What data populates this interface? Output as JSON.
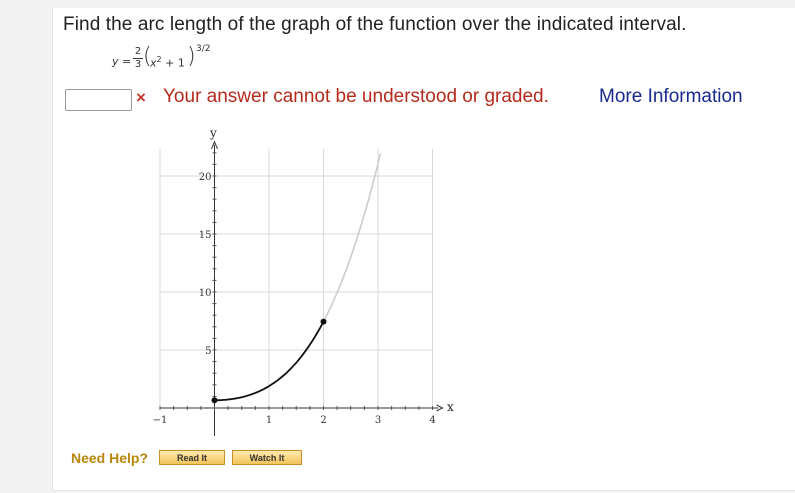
{
  "question": {
    "prompt": "Find the arc length of the graph of the function over the indicated interval.",
    "formula": {
      "lhs": "y",
      "eq": "=",
      "frac_num": "2",
      "frac_den": "3",
      "paren_open": "(",
      "inner_var": "x",
      "inner_sup": "2",
      "inner_rest": " + 1",
      "paren_close": ")",
      "exponent": "3/2"
    }
  },
  "answer": {
    "value": "",
    "status_mark": "×",
    "error_text": "Your answer cannot be understood or graded.",
    "more_info_label": "More Information"
  },
  "colors": {
    "error": "#b52a1c",
    "link": "#1a2a8c",
    "help": "#b8860b",
    "curve_highlight": "#111111",
    "curve_faded": "#cccccc"
  },
  "chart_data": {
    "type": "line",
    "xlabel": "x",
    "ylabel": "y",
    "xlim": [
      -1,
      4
    ],
    "ylim": [
      0,
      22
    ],
    "x_ticks": [
      -1,
      1,
      2,
      3,
      4
    ],
    "y_ticks": [
      5,
      10,
      15,
      20
    ],
    "grid": true,
    "function": "y = (2/3)(x^2+1)^(3/2)",
    "series": [
      {
        "style": "highlighted",
        "x": [
          0,
          0.5,
          1,
          1.5,
          2
        ],
        "y": [
          0.67,
          0.93,
          1.89,
          3.91,
          7.45
        ]
      },
      {
        "style": "faded",
        "x": [
          2,
          2.5,
          3,
          3.1
        ],
        "y": [
          7.45,
          12.93,
          21.08,
          22.0
        ]
      }
    ],
    "endpoints": [
      {
        "x": 0,
        "y": 0.67
      },
      {
        "x": 2,
        "y": 7.45
      }
    ]
  },
  "help": {
    "label": "Need Help?",
    "read_it": "Read It",
    "watch_it": "Watch It"
  }
}
